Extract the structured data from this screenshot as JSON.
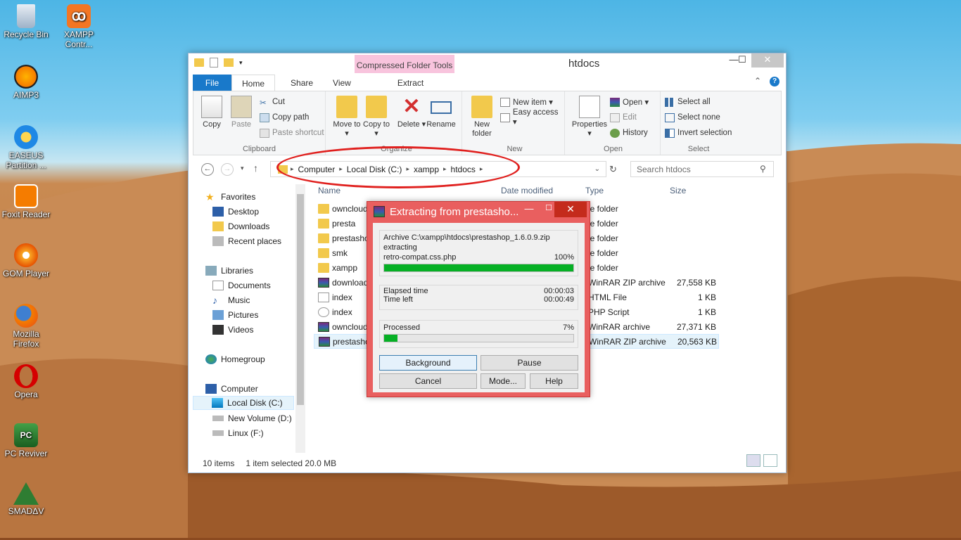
{
  "desktop": {
    "icons": [
      {
        "label": "Recycle Bin",
        "icon": "recycle-bin-icon"
      },
      {
        "label": "XAMPP Contr...",
        "icon": "xampp-icon"
      },
      {
        "label": "AIMP3",
        "icon": "aimp-icon"
      },
      {
        "label": "EASEUS Partition ...",
        "icon": "easeus-icon"
      },
      {
        "label": "Foxit Reader",
        "icon": "foxit-icon"
      },
      {
        "label": "GOM Player",
        "icon": "gom-icon"
      },
      {
        "label": "Mozilla Firefox",
        "icon": "firefox-icon"
      },
      {
        "label": "Opera",
        "icon": "opera-icon"
      },
      {
        "label": "PC Reviver",
        "icon": "pc-reviver-icon"
      },
      {
        "label": "SMADΔV",
        "icon": "smadav-icon"
      }
    ]
  },
  "explorer": {
    "title": "htdocs",
    "context_tab": "Compressed Folder Tools",
    "tabs": [
      "File",
      "Home",
      "Share",
      "View",
      "Extract"
    ],
    "window_buttons": {
      "minimize": "—",
      "maximize": "☐",
      "close": "✕"
    },
    "ribbon": {
      "clipboard": {
        "label": "Clipboard",
        "copy": "Copy",
        "paste": "Paste",
        "cut": "Cut",
        "copy_path": "Copy path",
        "paste_shortcut": "Paste shortcut"
      },
      "organize": {
        "label": "Organize",
        "move_to": "Move to ▾",
        "copy_to": "Copy to ▾",
        "delete": "Delete ▾",
        "rename": "Rename"
      },
      "new": {
        "label": "New",
        "new_folder": "New folder",
        "new_item": "New item ▾",
        "easy_access": "Easy access ▾"
      },
      "open": {
        "label": "Open",
        "properties": "Properties ▾",
        "open": "Open ▾",
        "edit": "Edit",
        "history": "History"
      },
      "select": {
        "label": "Select",
        "select_all": "Select all",
        "select_none": "Select none",
        "invert": "Invert selection"
      }
    },
    "address": {
      "crumbs": [
        "Computer",
        "Local Disk (C:)",
        "xampp",
        "htdocs"
      ],
      "search_placeholder": "Search htdocs"
    },
    "nav": {
      "favorites": "Favorites",
      "desktop": "Desktop",
      "downloads": "Downloads",
      "recent": "Recent places",
      "libraries": "Libraries",
      "documents": "Documents",
      "music": "Music",
      "pictures": "Pictures",
      "videos": "Videos",
      "homegroup": "Homegroup",
      "computer": "Computer",
      "local_disk": "Local Disk (C:)",
      "new_volume": "New Volume (D:)",
      "linux": "Linux (F:)"
    },
    "columns": {
      "name": "Name",
      "date": "Date modified",
      "type": "Type",
      "size": "Size"
    },
    "files": [
      {
        "name": "owncloud",
        "type": "le folder",
        "size": "",
        "icon": "folder-icon"
      },
      {
        "name": "presta",
        "type": "le folder",
        "size": "",
        "icon": "folder-icon"
      },
      {
        "name": "prestashop",
        "type": "le folder",
        "size": "",
        "icon": "folder-icon"
      },
      {
        "name": "smk",
        "type": "le folder",
        "size": "",
        "icon": "folder-icon"
      },
      {
        "name": "xampp",
        "type": "le folder",
        "size": "",
        "icon": "folder-icon"
      },
      {
        "name": "download",
        "type": "WinRAR ZIP archive",
        "size": "27,558 KB",
        "icon": "winrar-icon"
      },
      {
        "name": "index",
        "type": "HTML File",
        "size": "1 KB",
        "icon": "html-icon"
      },
      {
        "name": "index",
        "type": "PHP Script",
        "size": "1 KB",
        "icon": "php-icon"
      },
      {
        "name": "owncloud",
        "type": "WinRAR archive",
        "size": "27,371 KB",
        "icon": "winrar-icon"
      },
      {
        "name": "prestashop",
        "type": "WinRAR ZIP archive",
        "size": "20,563 KB",
        "icon": "winrar-icon"
      }
    ],
    "status": {
      "count": "10 items",
      "selected": "1 item selected  20.0 MB"
    }
  },
  "winrar": {
    "title": "Extracting from prestasho...",
    "archive": "Archive C:\\xampp\\htdocs\\prestashop_1.6.0.9.zip",
    "action": "extracting",
    "current_file": "retro-compat.css.php",
    "file_percent": "100%",
    "file_progress": 100,
    "elapsed_label": "Elapsed time",
    "elapsed": "00:00:03",
    "left_label": "Time left",
    "left": "00:00:49",
    "processed_label": "Processed",
    "processed_percent": "7%",
    "processed_progress": 7,
    "buttons": {
      "background": "Background",
      "pause": "Pause",
      "cancel": "Cancel",
      "mode": "Mode...",
      "help": "Help"
    }
  }
}
